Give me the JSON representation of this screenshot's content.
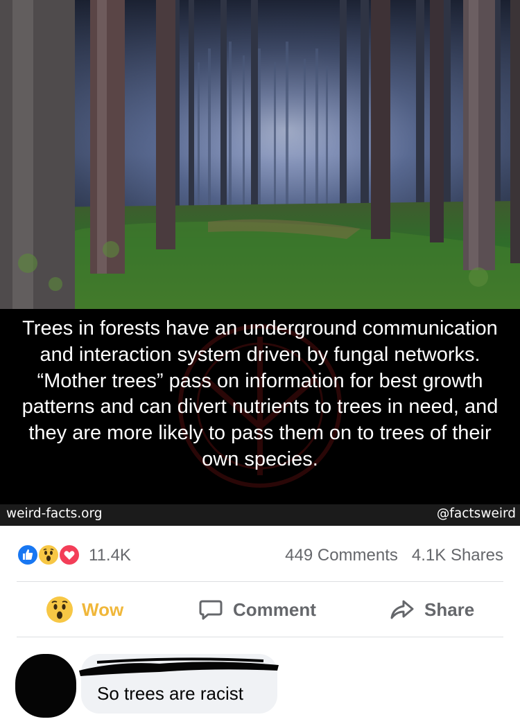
{
  "post": {
    "caption": "Trees in forests have an underground communication and interaction system driven by fungal networks. “Mother trees” pass on information for best growth patterns and can divert nutrients to trees in need, and they are more likely to pass them on to trees of their own species.",
    "site": "weird-facts.org",
    "handle": "@factsweird"
  },
  "reactions": {
    "icons": [
      "like-icon",
      "wow-icon",
      "love-icon"
    ],
    "count": "11.4K",
    "comments": "449 Comments",
    "shares": "4.1K Shares"
  },
  "actions": {
    "reaction_label": "Wow",
    "comment_label": "Comment",
    "share_label": "Share"
  },
  "comment": {
    "text": "So trees are racist"
  },
  "colors": {
    "wow": "#f0b73a",
    "like": "#1877f2",
    "love": "#f33e58",
    "muted": "#65676b",
    "bubble": "#f0f2f5"
  }
}
